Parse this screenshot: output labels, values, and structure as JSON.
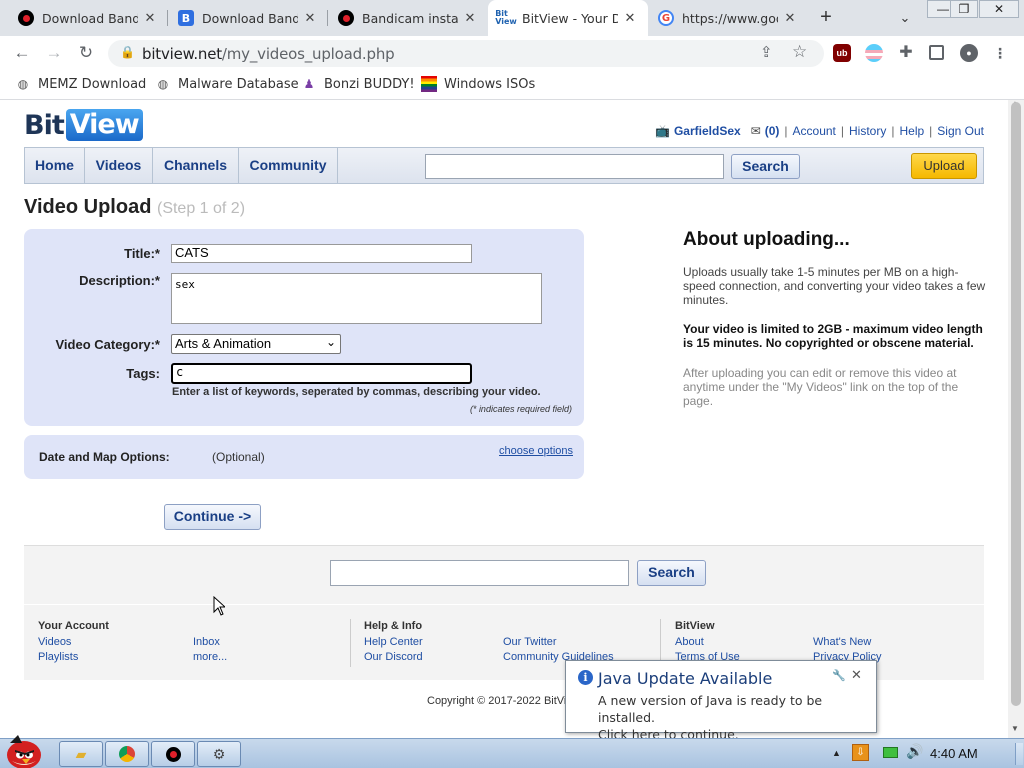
{
  "browser": {
    "tabs": [
      {
        "title": "Download Bandi",
        "icon": "record-icon"
      },
      {
        "title": "Download Bandi",
        "icon": "bandicam-icon"
      },
      {
        "title": "Bandicam install",
        "icon": "record-icon"
      },
      {
        "title": "BitView - Your D",
        "icon": "bitview-icon",
        "active": true
      },
      {
        "title": "https://www.goo",
        "icon": "google-icon"
      }
    ],
    "new_tab": "+",
    "tab_search": "⌄",
    "window": {
      "minimize": "—",
      "restore": "❐",
      "close": "✕"
    },
    "nav": {
      "back": "←",
      "forward": "→",
      "reload": "↻"
    },
    "url": {
      "host": "bitview.net",
      "path": "/my_videos_upload.php"
    },
    "extensions": [
      "uBlock",
      "flag",
      "puzzle",
      "sidebar",
      "profile",
      "menu"
    ],
    "bookmarks": [
      {
        "label": "MEMZ Download",
        "icon": "globe-icon"
      },
      {
        "label": "Malware Database",
        "icon": "globe-icon"
      },
      {
        "label": "Bonzi BUDDY!",
        "icon": "bonzi-icon"
      },
      {
        "label": "Windows ISOs",
        "icon": "rainbow-flag-icon"
      }
    ]
  },
  "site": {
    "logo": {
      "bit": "Bit",
      "view": "View"
    },
    "user": {
      "name": "GarfieldSex",
      "inbox": "(0)",
      "links": [
        "Account",
        "History",
        "Help",
        "Sign Out"
      ]
    },
    "nav": [
      "Home",
      "Videos",
      "Channels",
      "Community"
    ],
    "search_label": "Search",
    "upload_label": "Upload"
  },
  "page": {
    "title": "Video Upload",
    "step": "(Step 1 of 2)",
    "form": {
      "title_label": "Title:*",
      "title_value": "CATS",
      "desc_label": "Description:*",
      "desc_value": "sex",
      "cat_label": "Video Category:*",
      "cat_value": "Arts & Animation",
      "tags_label": "Tags:",
      "tags_value": "c",
      "tags_hint": "Enter a list of keywords, seperated by commas, describing your video.",
      "required_note": "(* indicates required field)"
    },
    "map": {
      "label": "Date and Map Options:",
      "optional": "(Optional)",
      "choose": "choose options"
    },
    "continue_label": "Continue ->",
    "about": {
      "title": "About uploading...",
      "p1": "Uploads usually take 1-5 minutes per MB on a high-speed connection, and converting your video takes a few minutes.",
      "p2": "Your video is limited to 2GB - maximum video length is 15 minutes. No copyrighted or obscene material.",
      "p3": "After uploading you can edit or remove this video at anytime under the \"My Videos\" link on the top of the page."
    }
  },
  "footer": {
    "search_label": "Search",
    "your_account": {
      "heading": "Your Account",
      "links": [
        "Videos",
        "Playlists",
        "Inbox",
        "more..."
      ]
    },
    "help": {
      "heading": "Help & Info",
      "links": [
        "Help Center",
        "Our Discord",
        "Our Twitter",
        "Community Guidelines"
      ]
    },
    "bitview": {
      "heading": "BitView",
      "links": [
        "About",
        "Terms of Use",
        "What's New",
        "Privacy Policy"
      ]
    },
    "copyright": "Copyright © 2017-2022 BitView"
  },
  "notification": {
    "title": "Java Update Available",
    "line1": "A new version of Java is ready to be installed.",
    "line2": "Click here to continue."
  },
  "taskbar": {
    "clock": "4:40 AM"
  }
}
